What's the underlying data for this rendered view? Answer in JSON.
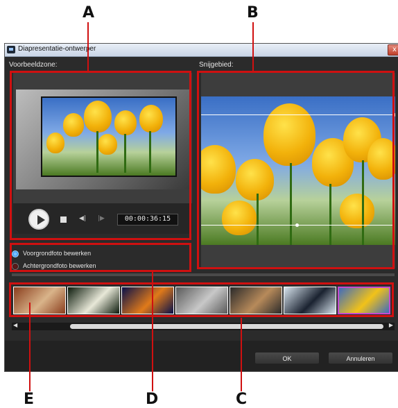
{
  "callouts": {
    "a": "A",
    "b": "B",
    "c": "C",
    "d": "D",
    "e": "E"
  },
  "window": {
    "title": "Diapresentatie-ontwerper",
    "close_glyph": "x"
  },
  "preview": {
    "label": "Voorbeeldzone:",
    "timecode": "00:00:36:15"
  },
  "crop": {
    "label": "Snijgebied:"
  },
  "options": {
    "foreground": "Voorgrondfoto bewerken",
    "background": "Achtergrondfoto bewerken",
    "selected": "foreground"
  },
  "thumbnails": [
    {
      "name": "canyon",
      "c1": "#8a3d1d",
      "c2": "#d9b48a",
      "border": "#ffffff",
      "selected": false
    },
    {
      "name": "flower",
      "c1": "#0b1a0b",
      "c2": "#e8e8d8",
      "border": "#ffffff",
      "selected": false
    },
    {
      "name": "jellyfish",
      "c1": "#07104a",
      "c2": "#e07a1a",
      "border": "#ffffff",
      "selected": false
    },
    {
      "name": "koala",
      "c1": "#5a5a5a",
      "c2": "#c8c8c8",
      "border": "#ffffff",
      "selected": false
    },
    {
      "name": "lighthouse",
      "c1": "#2a2a2a",
      "c2": "#b78a5a",
      "border": "#ffffff",
      "selected": false
    },
    {
      "name": "penguins",
      "c1": "#d8e4ee",
      "c2": "#1a2230",
      "border": "#ffffff",
      "selected": false
    },
    {
      "name": "tulips",
      "c1": "#3f6bbd",
      "c2": "#f1c219",
      "border": "#c44bd1",
      "selected": true
    }
  ],
  "scrollbar": {
    "left_arrow": "◀",
    "right_arrow": "▶"
  },
  "buttons": {
    "ok": "OK",
    "cancel": "Annuleren"
  },
  "colors": {
    "callout_red": "#d01010",
    "dialog_bg": "#2b2b2b",
    "panel_bg": "#3d3d3d",
    "accent_blue": "#2a8bea"
  }
}
